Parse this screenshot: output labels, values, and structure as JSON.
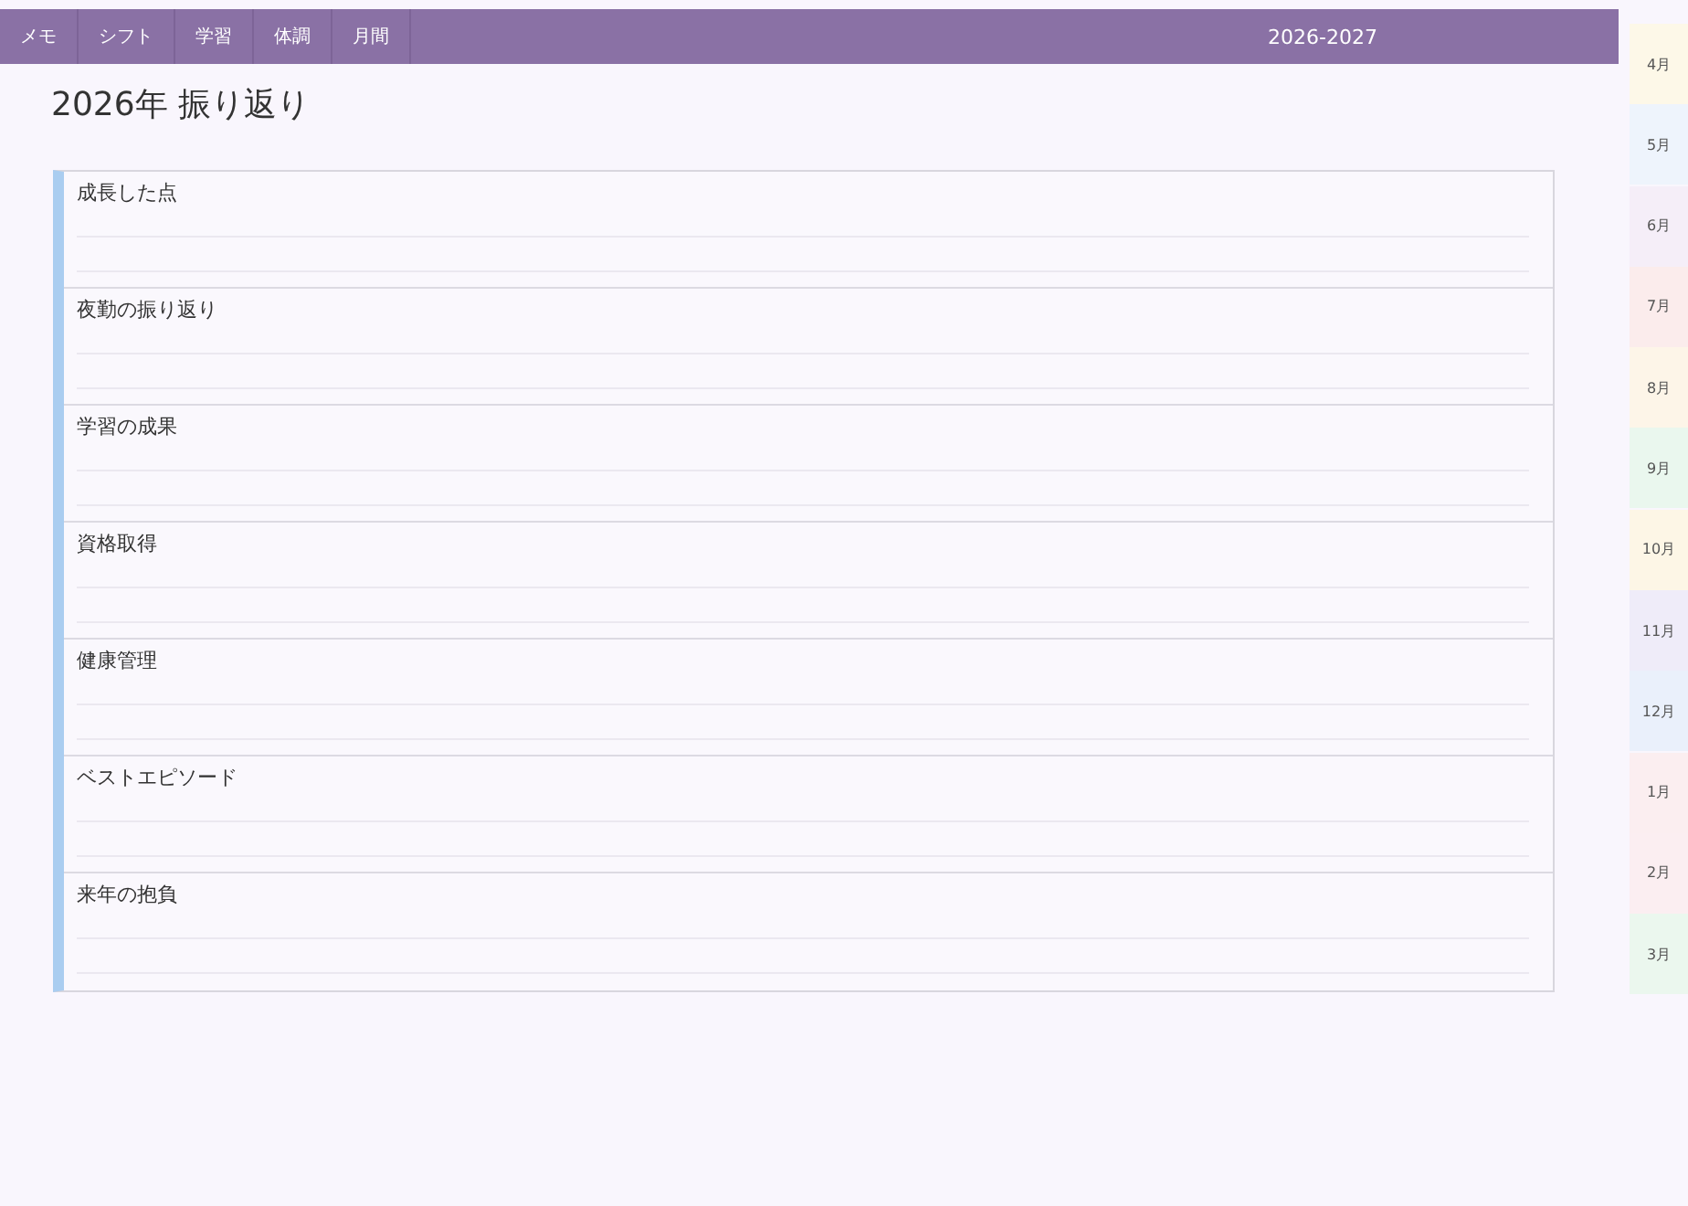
{
  "nav": {
    "tabs": [
      {
        "label": "メモ"
      },
      {
        "label": "シフト"
      },
      {
        "label": "学習"
      },
      {
        "label": "体調"
      },
      {
        "label": "月間"
      }
    ],
    "year_range": "2026-2027"
  },
  "title": "2026年 振り返り",
  "sections": [
    {
      "heading": "成長した点"
    },
    {
      "heading": "夜勤の振り返り"
    },
    {
      "heading": "学習の成果"
    },
    {
      "heading": "資格取得"
    },
    {
      "heading": "健康管理"
    },
    {
      "heading": "ベストエピソード"
    },
    {
      "heading": "来年の抱負"
    }
  ],
  "month_tabs": [
    {
      "label": "4月",
      "color": "#fdf8e8"
    },
    {
      "label": "5月",
      "color": "#eef4fc"
    },
    {
      "label": "6月",
      "color": "#f5eef8"
    },
    {
      "label": "7月",
      "color": "#fbecec"
    },
    {
      "label": "8月",
      "color": "#fdf5e8"
    },
    {
      "label": "9月",
      "color": "#eaf7ee"
    },
    {
      "label": "10月",
      "color": "#fdf6e6"
    },
    {
      "label": "11月",
      "color": "#efecf9"
    },
    {
      "label": "12月",
      "color": "#eaf0fb"
    },
    {
      "label": "1月",
      "color": "#fbeef0"
    },
    {
      "label": "2月",
      "color": "#fbeef1"
    },
    {
      "label": "3月",
      "color": "#ebf7ee"
    }
  ]
}
